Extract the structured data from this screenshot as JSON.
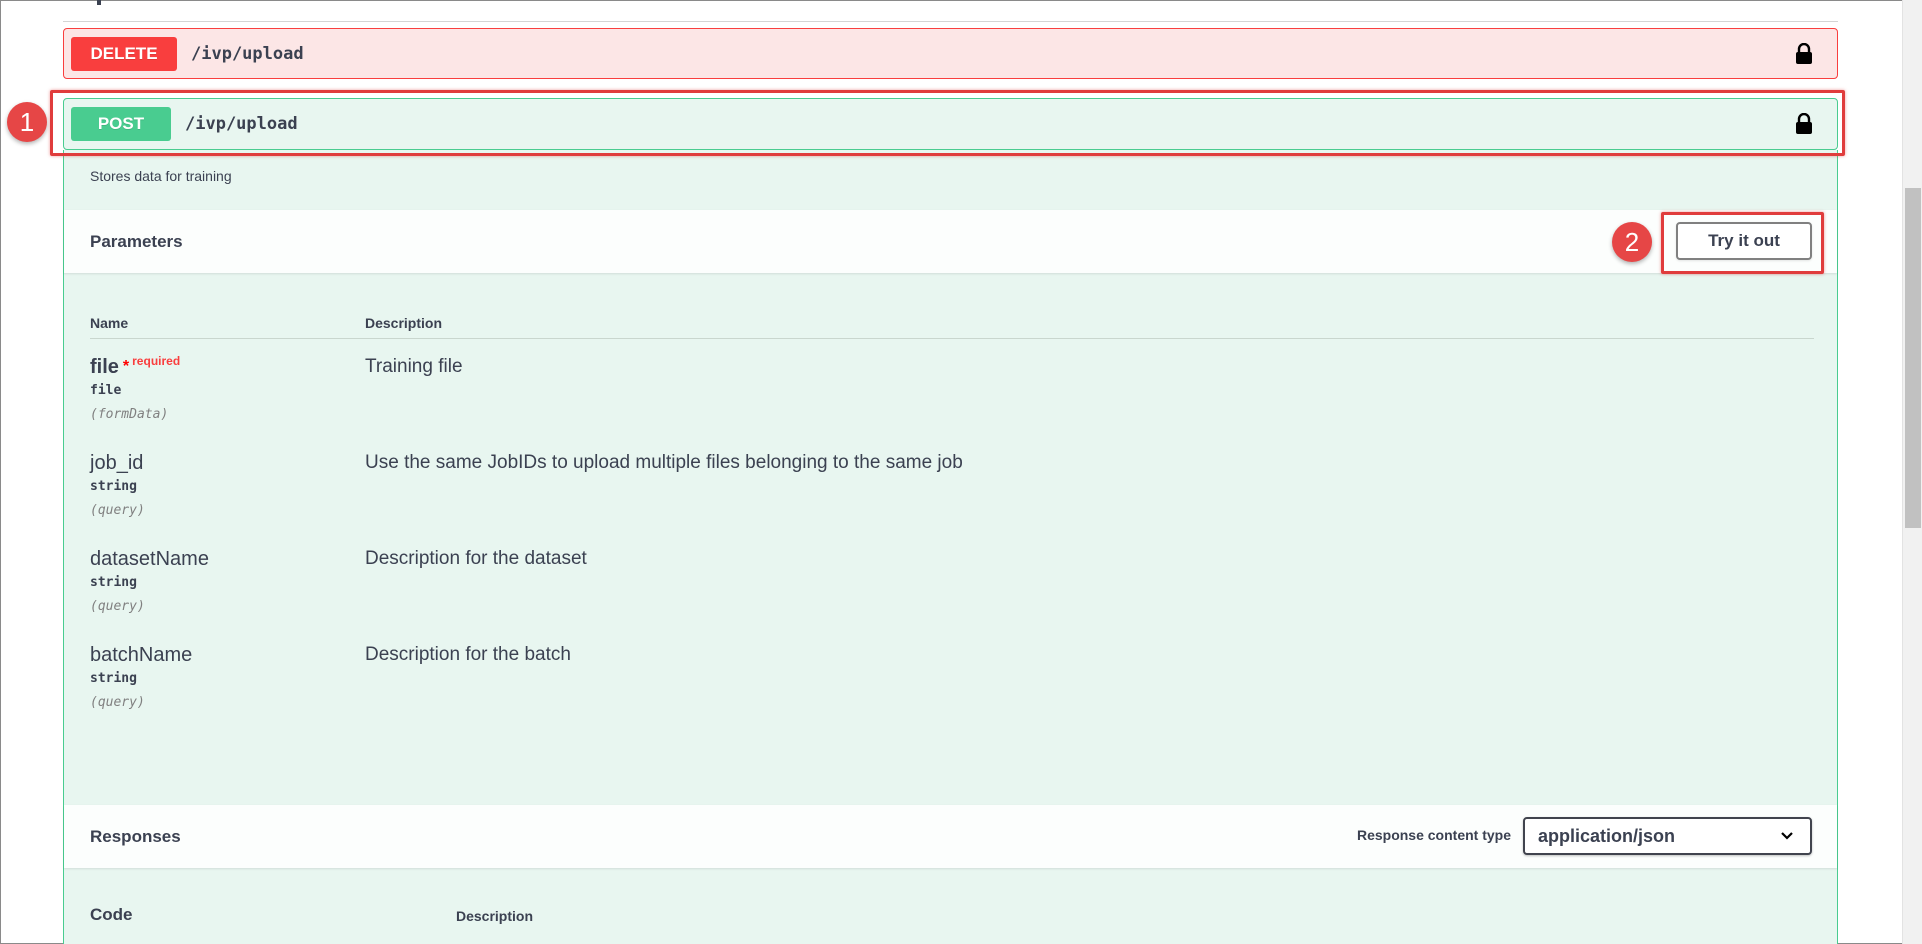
{
  "operations": [
    {
      "method": "DELETE",
      "path": "/ivp/upload"
    },
    {
      "method": "POST",
      "path": "/ivp/upload"
    }
  ],
  "expanded": {
    "summary": "Stores data for training",
    "parameters_title": "Parameters",
    "try_it_out_label": "Try it out",
    "columns": {
      "name": "Name",
      "description": "Description"
    },
    "params": [
      {
        "name": "file",
        "required_star": "*",
        "required_label": "required",
        "type": "file",
        "in": "(formData)",
        "description": "Training file"
      },
      {
        "name": "job_id",
        "type": "string",
        "in": "(query)",
        "description": "Use the same JobIDs to upload multiple files belonging to the same job"
      },
      {
        "name": "datasetName",
        "type": "string",
        "in": "(query)",
        "description": "Description for the dataset"
      },
      {
        "name": "batchName",
        "type": "string",
        "in": "(query)",
        "description": "Description for the batch"
      }
    ],
    "responses_title": "Responses",
    "content_type_label": "Response content type",
    "content_type_value": "application/json",
    "response_columns": {
      "code": "Code",
      "description": "Description"
    }
  },
  "annotations": [
    "1",
    "2"
  ],
  "colors": {
    "delete": "#f93e3e",
    "post": "#49cc90",
    "annotation": "#e03c3c"
  }
}
